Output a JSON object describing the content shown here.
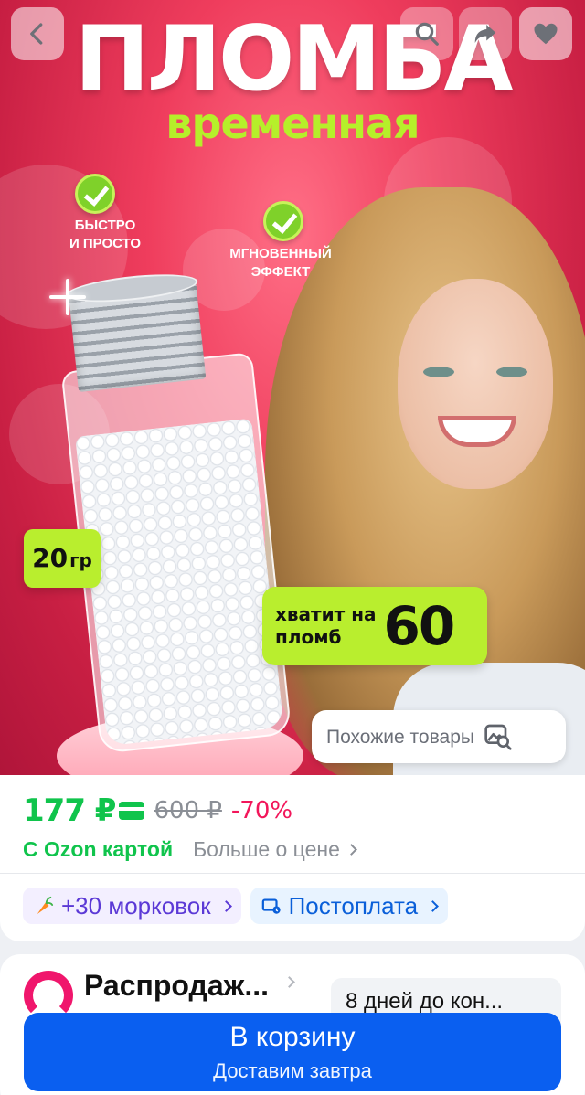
{
  "product_image": {
    "title": "ПЛОМБА",
    "subtitle": "временная",
    "features": [
      "быстро\nи просто",
      "мгновенный\nэффект"
    ],
    "weight_value": "20",
    "weight_unit": "гр",
    "fill_text": "хватит на\nпломб",
    "fill_count": "60"
  },
  "top_buttons": {
    "back_icon": "chevron-left-icon",
    "search_icon": "search-icon",
    "share_icon": "share-icon",
    "favorite_icon": "heart-icon"
  },
  "similar_button": {
    "label": "Похожие товары",
    "icon": "image-search-icon"
  },
  "price": {
    "current": "177 ₽",
    "old": "600 ₽",
    "discount": "-70%",
    "ozon_card": "С Ozon картой",
    "more": "Больше о цене",
    "colors": {
      "price": "#10c44c",
      "discount": "#f2165a"
    }
  },
  "chips": {
    "points": "+30 морковок",
    "postpay": "Постоплата"
  },
  "promo": {
    "title": "Распродаж...",
    "timer": "8 дней до кон..."
  },
  "cart": {
    "label": "В корзину",
    "sublabel": "Доставим завтра",
    "color": "#0a5ff0"
  }
}
